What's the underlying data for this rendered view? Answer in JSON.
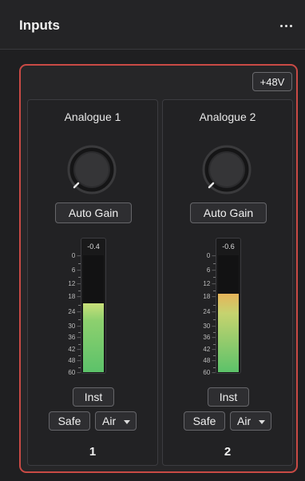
{
  "header": {
    "title": "Inputs",
    "more_icon": "more-horizontal-icon"
  },
  "phantom_power": {
    "label": "+48V"
  },
  "channels": [
    {
      "name": "Analogue 1",
      "auto_gain_label": "Auto Gain",
      "peak_label": "-0.4",
      "meter_level": 0.59,
      "meter_colors": {
        "top": "#c9e07a",
        "mid": "#8dd06e",
        "bottom": "#5cc26a"
      },
      "inst_label": "Inst",
      "safe_label": "Safe",
      "air_label": "Air",
      "number": "1"
    },
    {
      "name": "Analogue 2",
      "auto_gain_label": "Auto Gain",
      "peak_label": "-0.6",
      "meter_level": 0.67,
      "meter_colors": {
        "top": "#e6b45a",
        "mid": "#c6d36f",
        "bottom": "#5cc26a"
      },
      "inst_label": "Inst",
      "safe_label": "Safe",
      "air_label": "Air",
      "number": "2"
    }
  ],
  "meter_scale": [
    "0",
    "6",
    "12",
    "18",
    "24",
    "30",
    "36",
    "42",
    "48",
    "60"
  ],
  "colors": {
    "panel_border": "#c94a45",
    "background": "#1f1f21"
  }
}
